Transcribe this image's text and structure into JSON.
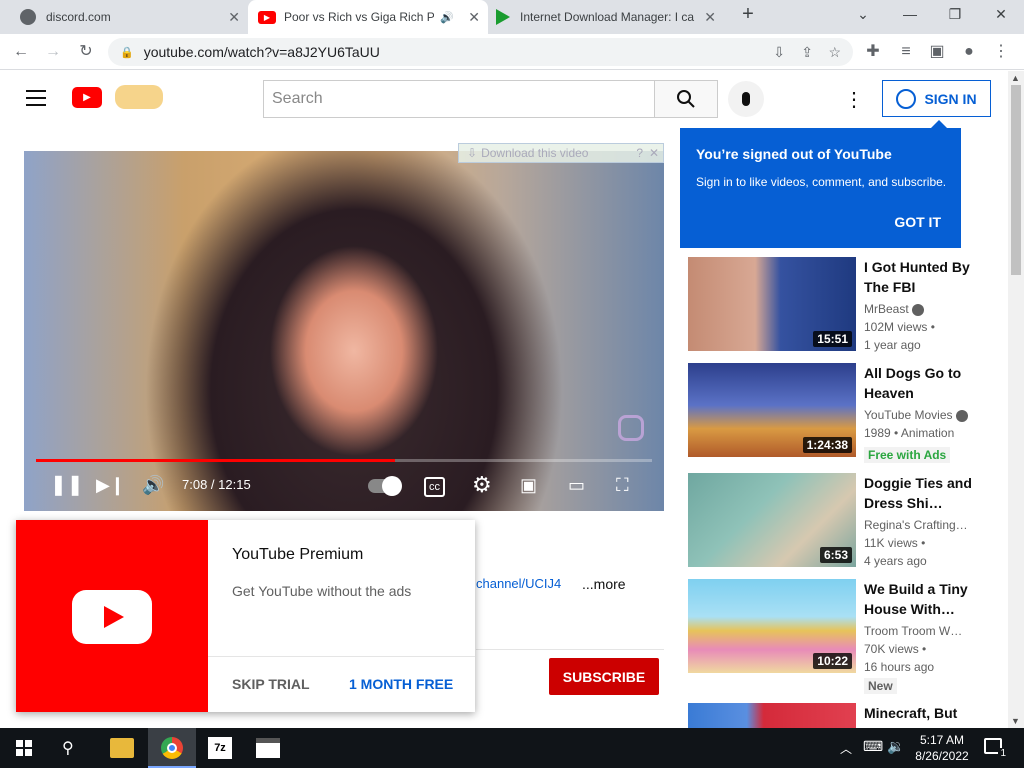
{
  "browser": {
    "tabs": [
      {
        "title": "discord.com"
      },
      {
        "title": "Poor vs Rich vs Giga Rich Pre"
      },
      {
        "title": "Internet Download Manager: I ca"
      }
    ],
    "url": "youtube.com/watch?v=a8J2YU6TaUU"
  },
  "yt": {
    "search_placeholder": "Search",
    "sign_in": "SIGN IN"
  },
  "player": {
    "download_label": "Download this video",
    "time": "7:08 / 12:15",
    "progress_fraction": 0.582
  },
  "signed_out": {
    "title": "You’re signed out of YouTube",
    "body": "Sign in to like videos, comment, and subscribe.",
    "button": "GOT IT"
  },
  "related": [
    {
      "title": "I Got Hunted By The FBI",
      "channel": "MrBeast",
      "views": "102M views •",
      "age": "1 year ago",
      "duration": "15:51",
      "badge": ""
    },
    {
      "title": "All Dogs Go to Heaven",
      "channel": "YouTube Movies",
      "views": "1989 • Animation",
      "age": "",
      "duration": "1:24:38",
      "badge": "Free with Ads"
    },
    {
      "title": "Doggie Ties and Dress Shi…",
      "channel": "Regina's Crafting…",
      "views": "11K views •",
      "age": "4 years ago",
      "duration": "6:53",
      "badge": ""
    },
    {
      "title": "We Build a Tiny House With…",
      "channel": "Troom Troom W…",
      "views": "70K views •",
      "age": "16 hours ago",
      "duration": "10:22",
      "badge": "New"
    },
    {
      "title": "Minecraft, But",
      "channel": "",
      "views": "",
      "age": "",
      "duration": "",
      "badge": ""
    }
  ],
  "below": {
    "channel_link": "channel/UCIJ4",
    "more": "...more",
    "subscribe": "SUBSCRIBE"
  },
  "promo": {
    "title": "YouTube Premium",
    "body": "Get YouTube without the ads",
    "skip": "SKIP TRIAL",
    "free": "1 MONTH FREE"
  },
  "taskbar": {
    "time": "5:17 AM",
    "date": "8/26/2022",
    "notifications": "1"
  },
  "colors": {
    "brand_red": "#ff0000",
    "link_blue": "#065fd4",
    "taskbar": "#101418"
  }
}
